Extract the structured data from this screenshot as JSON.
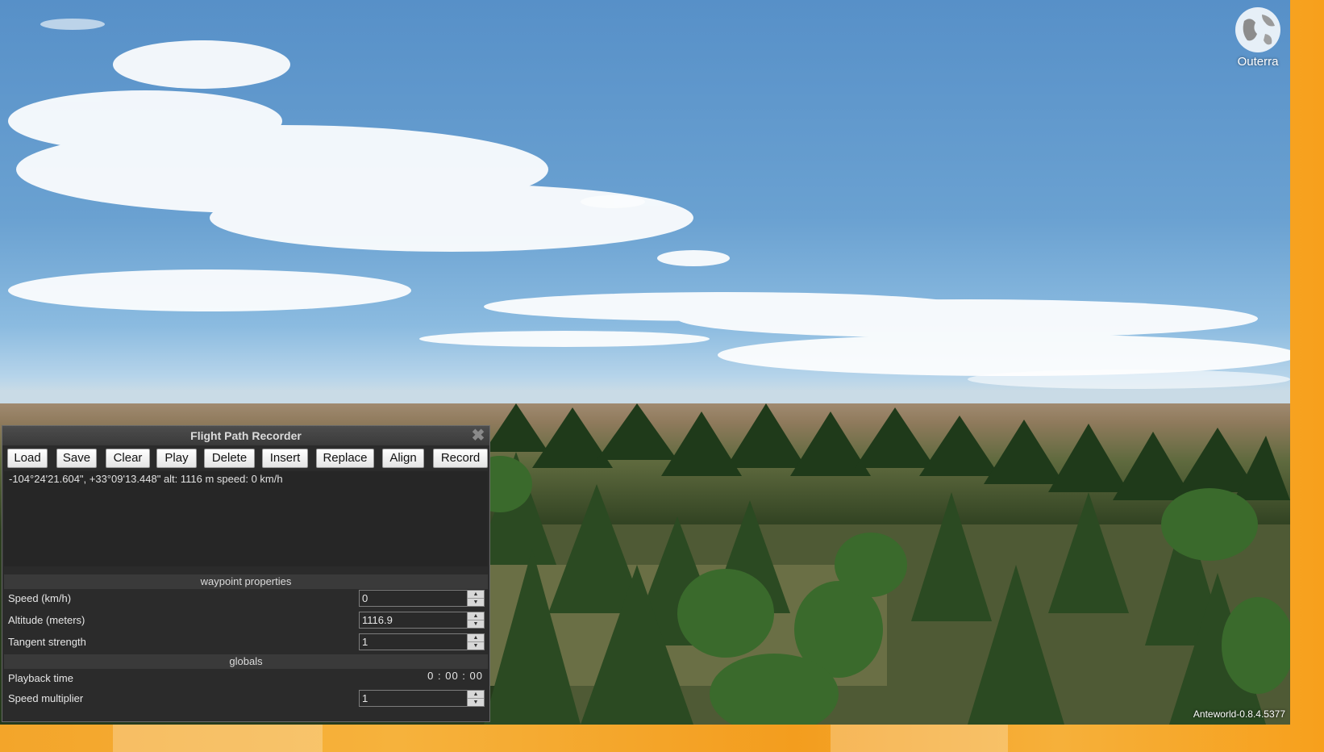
{
  "logo": {
    "name": "Outerra",
    "icon": "globe-icon"
  },
  "version": "Anteworld-0.8.4.5377",
  "panel": {
    "title": "Flight Path Recorder",
    "close_icon": "close-icon",
    "buttons": [
      "Load",
      "Save",
      "Clear",
      "Play",
      "Delete",
      "Insert",
      "Replace",
      "Align",
      "Record"
    ],
    "status": "-104°24'21.604\", +33°09'13.448\" alt: 1116 m speed: 0 km/h",
    "waypoint_properties": {
      "header": "waypoint properties",
      "speed_label": "Speed (km/h)",
      "speed_value": "0",
      "altitude_label": "Altitude (meters)",
      "altitude_value": "1116.9",
      "tangent_label": "Tangent strength",
      "tangent_value": "1"
    },
    "globals": {
      "header": "globals",
      "playback_label": "Playback time",
      "playback_value": "0 : 00 : 00",
      "multiplier_label": "Speed multiplier",
      "multiplier_value": "1"
    }
  }
}
